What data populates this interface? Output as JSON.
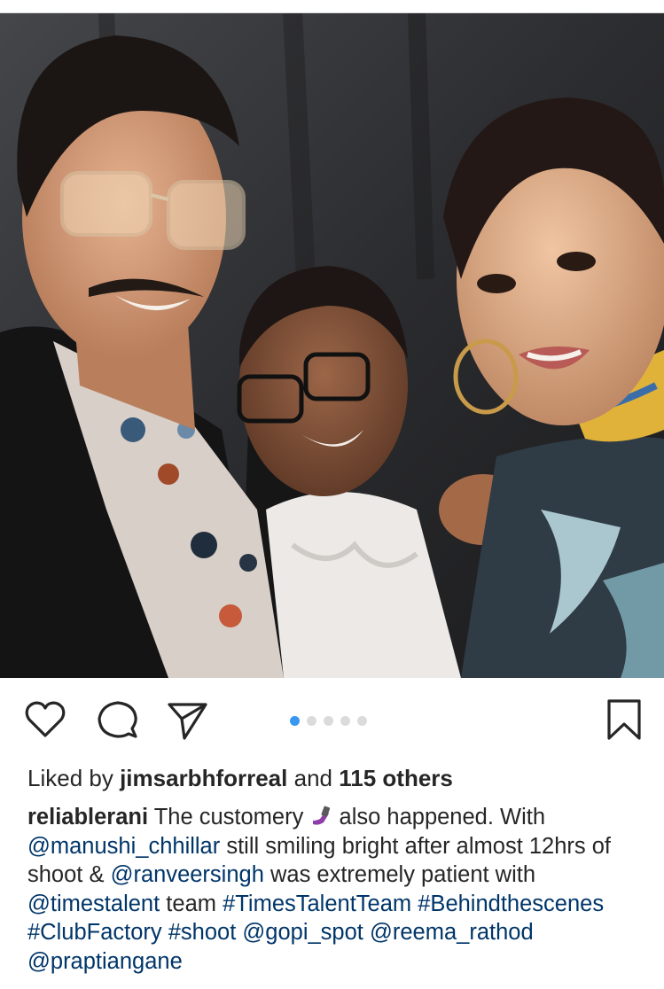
{
  "photo": {
    "description_icon": "photo"
  },
  "carousel": {
    "count": 5,
    "active_index": 0
  },
  "icons": {
    "like": "heart-icon",
    "comment": "comment-icon",
    "share": "share-icon",
    "save": "bookmark-icon"
  },
  "likes": {
    "prefix": "Liked by",
    "user": "jimsarbhforreal",
    "middle": "and",
    "others": "115 others"
  },
  "caption": {
    "username": "reliablerani",
    "t1": "The customery",
    "t2": "also happened. With",
    "m1": "@manushi_chhillar",
    "t3": "still smiling bright after almost 12hrs of shoot &",
    "m2": "@ranveersingh",
    "t4": "was extremely patient with",
    "m3": "@timestalent",
    "t5": "team",
    "h1": "#TimesTalentTeam",
    "h2": "#Behindthescenes",
    "h3": "#ClubFactory",
    "h4": "#shoot",
    "m4": "@gopi_spot",
    "m5": "@reema_rathod",
    "m6": "@praptiangane"
  },
  "colors": {
    "link": "#003569",
    "accent": "#3897f0",
    "text": "#262626"
  }
}
